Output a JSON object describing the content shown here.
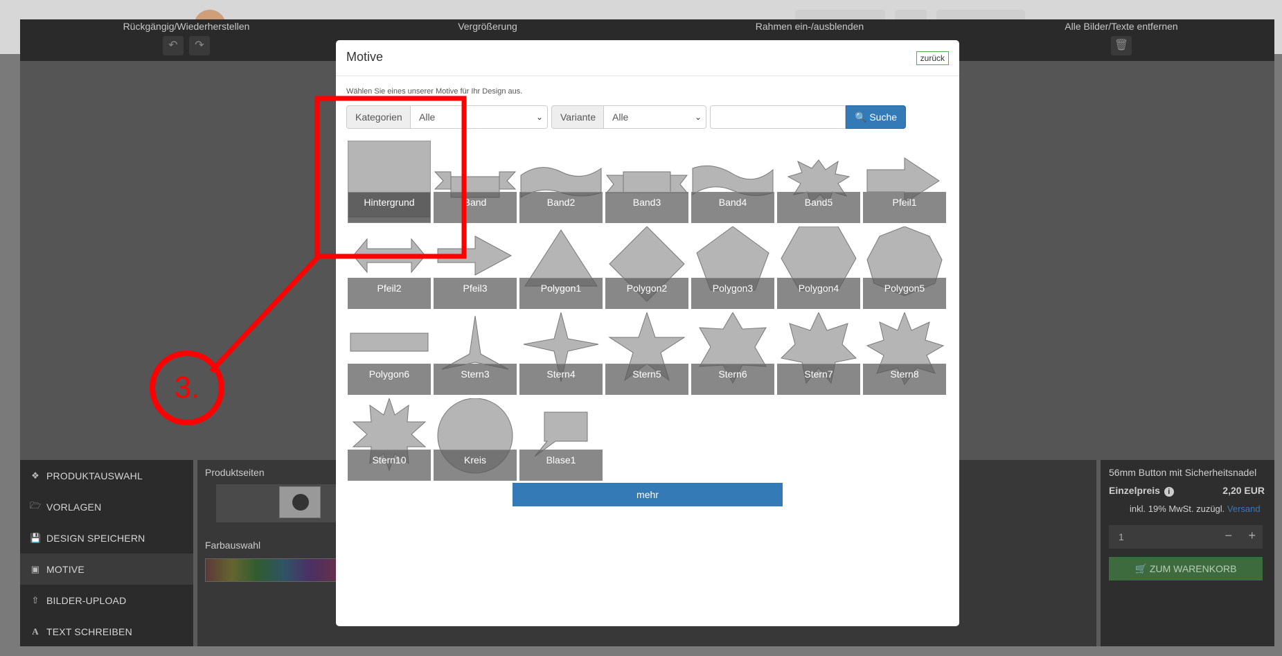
{
  "toolbar": {
    "undo_redo_label": "Rückgängig/Wiederherstellen",
    "zoom_label": "Vergrößerung",
    "frame_label": "Rahmen ein-/ausblenden",
    "remove_label": "Alle Bilder/Texte entfernen"
  },
  "side_menu": [
    {
      "label": "PRODUKTAUSWAHL",
      "icon": "cubes-icon"
    },
    {
      "label": "VORLAGEN",
      "icon": "folder-icon"
    },
    {
      "label": "DESIGN SPEICHERN",
      "icon": "save-icon"
    },
    {
      "label": "MOTIVE",
      "icon": "image-icon"
    },
    {
      "label": "BILDER-UPLOAD",
      "icon": "upload-icon"
    },
    {
      "label": "TEXT SCHREIBEN",
      "icon": "text-icon"
    }
  ],
  "mid_panel": {
    "product_pages_title": "Produktseiten",
    "color_title": "Farbauswahl"
  },
  "right_panel": {
    "product_name": "56mm Button mit Sicherheitsnadel",
    "price_label": "Einzelpreis",
    "price": "2,20 EUR",
    "vat_text": "inkl. 19% MwSt. zuzügl.",
    "shipping_link": "Versand",
    "quantity": "1",
    "cart_button": "ZUM WARENKORB"
  },
  "modal": {
    "title": "Motive",
    "back_button": "zurück",
    "intro": "Wählen Sie eines unserer Motive für Ihr Design aus.",
    "category_label": "Kategorien",
    "category_value": "Alle",
    "variant_label": "Variante",
    "variant_value": "Alle",
    "search_value": "",
    "search_button": "Suche",
    "more_button": "mehr",
    "motifs": [
      "Hintergrund",
      "Band",
      "Band2",
      "Band3",
      "Band4",
      "Band5",
      "Pfeil1",
      "Pfeil2",
      "Pfeil3",
      "Polygon1",
      "Polygon2",
      "Polygon3",
      "Polygon4",
      "Polygon5",
      "Polygon6",
      "Stern3",
      "Stern4",
      "Stern5",
      "Stern6",
      "Stern7",
      "Stern8",
      "Stern10",
      "Kreis",
      "Blase1"
    ]
  },
  "annotation": {
    "step_label": "3.",
    "color": "#ff0000"
  }
}
